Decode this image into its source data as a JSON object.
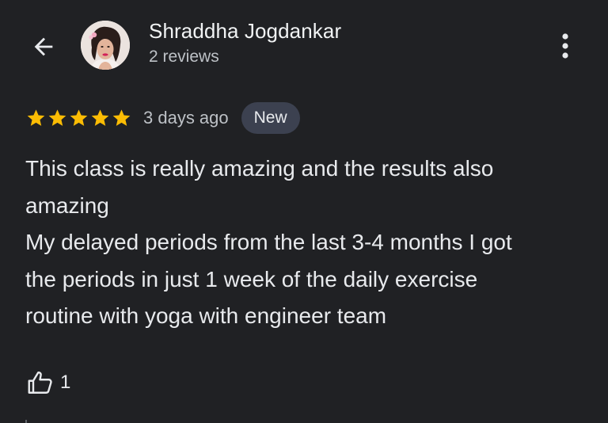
{
  "reviewer": {
    "name": "Shraddha Jogdankar",
    "meta": "2 reviews"
  },
  "review": {
    "rating": 5,
    "max_rating": 5,
    "date": "3 days ago",
    "badge": "New",
    "lines": [
      "This class is really amazing and the results also",
      "amazing",
      "My delayed periods from the last 3-4 months I got",
      "the periods in just 1 week of the daily exercise",
      "routine with yoga with engineer team"
    ]
  },
  "helpful": {
    "count": "1"
  },
  "icons": {
    "back": "arrow-back-icon",
    "more": "more-vert-icon",
    "star": "star-icon",
    "thumb": "thumb-up-icon"
  },
  "colors": {
    "background": "#202124",
    "star": "#fbbc04",
    "badge_bg": "#3c4150",
    "text_primary": "#e8eaed",
    "text_secondary": "#bdc1c6"
  }
}
